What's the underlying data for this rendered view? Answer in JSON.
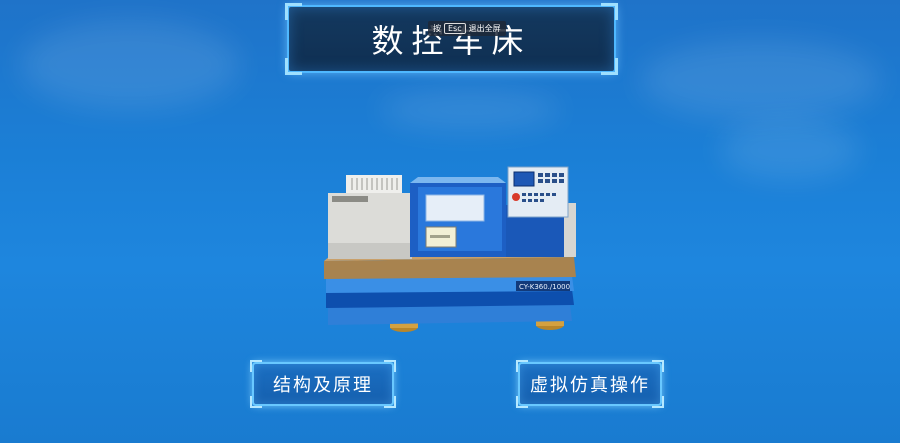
{
  "header": {
    "title": "数控车床",
    "esc_hint": {
      "prefix": "按",
      "key": "Esc",
      "suffix": "退出全屏"
    }
  },
  "model": {
    "plate_label": "CY-K360./1000"
  },
  "menu": {
    "structure_label": "结构及原理",
    "simulation_label": "虚拟仿真操作"
  }
}
